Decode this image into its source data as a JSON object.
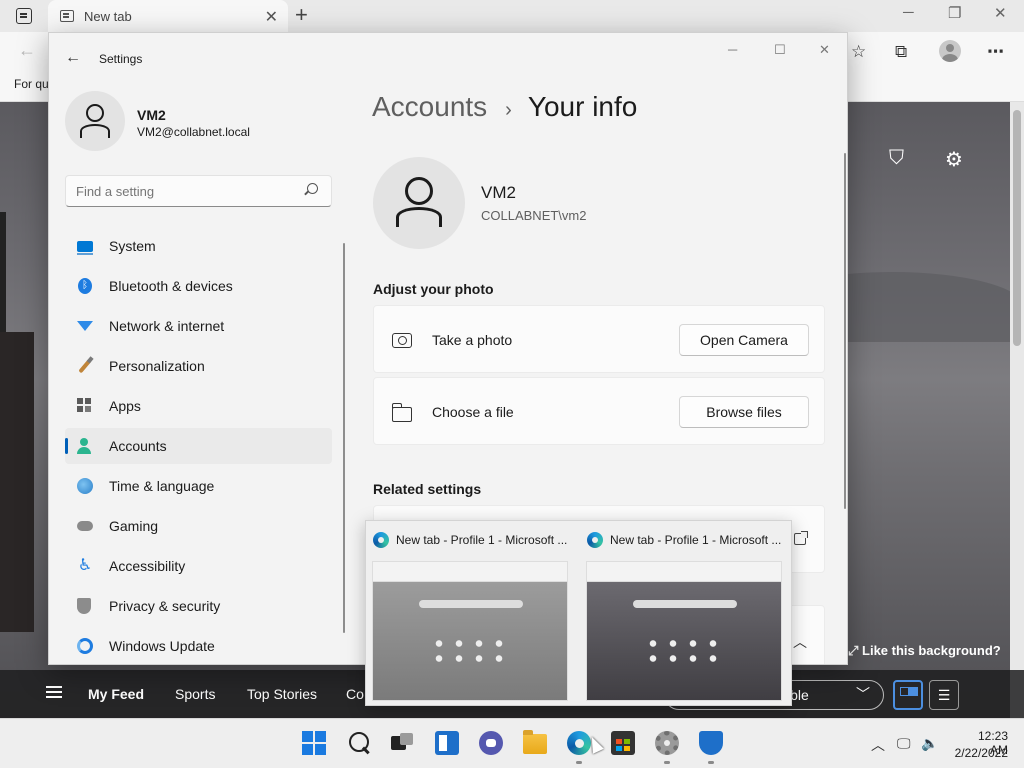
{
  "browser": {
    "tab_title": "New tab",
    "favorites_text": "For qu",
    "like_background": "Like this background?",
    "feed": {
      "items": [
        "My Feed",
        "Sports",
        "Top Stories",
        "Co"
      ],
      "visibility_partial": "ible"
    }
  },
  "settings": {
    "app_title": "Settings",
    "user": {
      "name": "VM2",
      "email": "VM2@collabnet.local"
    },
    "search": {
      "placeholder": "Find a setting"
    },
    "nav": [
      {
        "label": "System",
        "icon": "system-icon"
      },
      {
        "label": "Bluetooth & devices",
        "icon": "bluetooth-icon"
      },
      {
        "label": "Network & internet",
        "icon": "network-icon"
      },
      {
        "label": "Personalization",
        "icon": "brush-icon"
      },
      {
        "label": "Apps",
        "icon": "apps-icon"
      },
      {
        "label": "Accounts",
        "icon": "accounts-icon",
        "selected": true
      },
      {
        "label": "Time & language",
        "icon": "globe-clock-icon"
      },
      {
        "label": "Gaming",
        "icon": "gamepad-icon"
      },
      {
        "label": "Accessibility",
        "icon": "accessibility-icon"
      },
      {
        "label": "Privacy & security",
        "icon": "shield-icon"
      },
      {
        "label": "Windows Update",
        "icon": "update-icon"
      }
    ],
    "breadcrumb": {
      "parent": "Accounts",
      "current": "Your info"
    },
    "profile": {
      "name": "VM2",
      "domain_user": "COLLABNET\\vm2"
    },
    "adjust_photo": {
      "heading": "Adjust your photo",
      "take_photo": {
        "label": "Take a photo",
        "button": "Open Camera"
      },
      "choose_file": {
        "label": "Choose a file",
        "button": "Browse files"
      }
    },
    "related_heading": "Related settings"
  },
  "taskbar_preview": {
    "thumbnails": [
      {
        "title": "New tab - Profile 1 - Microsoft ..."
      },
      {
        "title": "New tab - Profile 1 - Microsoft ..."
      }
    ]
  },
  "system_tray": {
    "time": "12:23 AM",
    "date": "2/22/2022"
  },
  "colors": {
    "accent": "#005fb8",
    "selected_bg": "#eaeaea",
    "window_bg": "#f3f3f3"
  }
}
